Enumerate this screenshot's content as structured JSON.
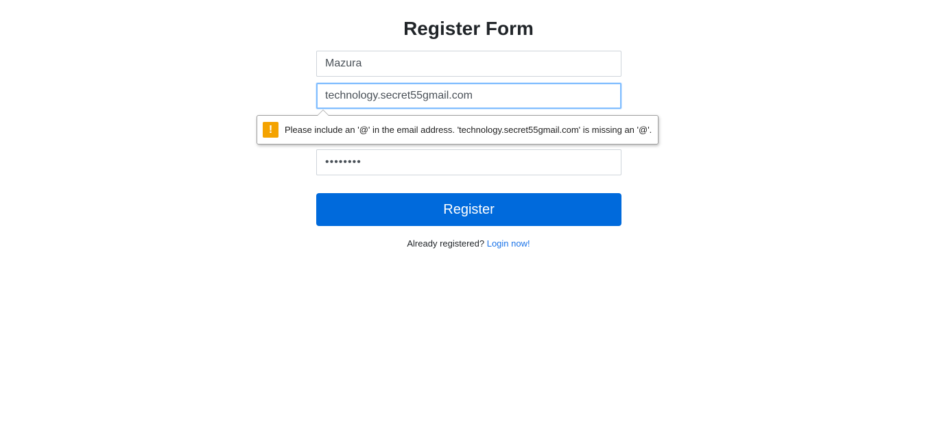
{
  "form": {
    "title": "Register Form",
    "name_value": "Mazura",
    "email_value": "technology.secret55gmail.com",
    "password_value": "password",
    "register_label": "Register",
    "login_prompt": "Already registered?",
    "login_link": "Login now!"
  },
  "validation": {
    "icon": "warning-icon",
    "message": "Please include an '@' in the email address. 'technology.secret55gmail.com' is missing an '@'."
  },
  "colors": {
    "primary_button": "#006adc",
    "link": "#1a73e8",
    "warning": "#f4a300",
    "focus_border": "#80bdff"
  }
}
